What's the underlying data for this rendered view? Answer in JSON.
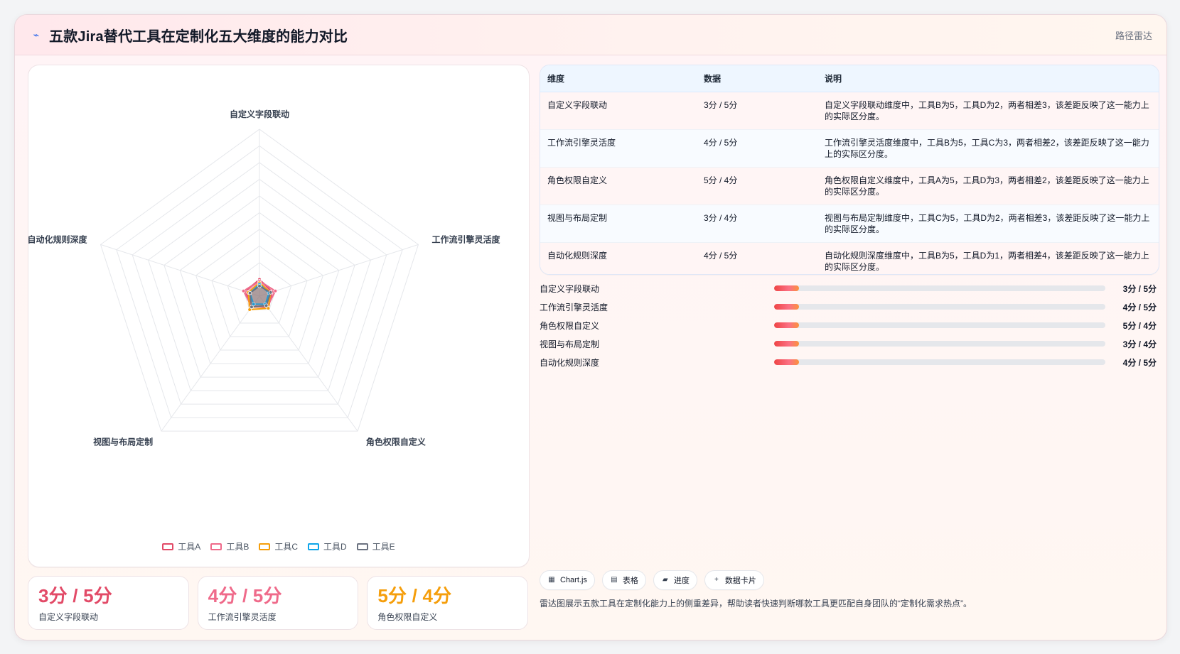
{
  "header": {
    "title": "五款Jira替代工具在定制化五大维度的能力对比",
    "tag": "路径雷达",
    "icon": "chart-line-icon"
  },
  "chart_data": {
    "type": "radar",
    "indicators": [
      "自定义字段联动",
      "工作流引擎灵活度",
      "角色权限自定义",
      "视图与布局定制",
      "自动化规则深度"
    ],
    "rmax": 100,
    "rings": 10,
    "series": [
      {
        "name": "工具A",
        "color": "#e24a67",
        "values": [
          10,
          8,
          9,
          7,
          9
        ]
      },
      {
        "name": "工具B",
        "color": "#ef6a8a",
        "values": [
          9,
          10,
          8,
          8,
          10
        ]
      },
      {
        "name": "工具C",
        "color": "#f59e0b",
        "values": [
          8,
          7,
          9,
          10,
          7
        ]
      },
      {
        "name": "工具D",
        "color": "#0ea5e9",
        "values": [
          7,
          6,
          6,
          6,
          6
        ]
      },
      {
        "name": "工具E",
        "color": "#6b7280",
        "values": [
          6,
          7,
          7,
          8,
          6
        ]
      }
    ],
    "legend": {
      "placement": "bottom"
    }
  },
  "table": {
    "headers": [
      "维度",
      "数据",
      "说明"
    ],
    "rows": [
      [
        "自定义字段联动",
        "3分 / 5分",
        "自定义字段联动维度中，工具B为5，工具D为2，两者相差3，该差距反映了这一能力上的实际区分度。"
      ],
      [
        "工作流引擎灵活度",
        "4分 / 5分",
        "工作流引擎灵活度维度中，工具B为5，工具C为3，两者相差2，该差距反映了这一能力上的实际区分度。"
      ],
      [
        "角色权限自定义",
        "5分 / 4分",
        "角色权限自定义维度中，工具A为5，工具D为3，两者相差2，该差距反映了这一能力上的实际区分度。"
      ],
      [
        "视图与布局定制",
        "3分 / 4分",
        "视图与布局定制维度中，工具C为5，工具D为2，两者相差3，该差距反映了这一能力上的实际区分度。"
      ],
      [
        "自动化规则深度",
        "4分 / 5分",
        "自动化规则深度维度中，工具B为5，工具D为1，两者相差4，该差距反映了这一能力上的实际区分度。"
      ]
    ]
  },
  "progress": {
    "items": [
      {
        "label": "自定义字段联动",
        "value": "3分 / 5分",
        "fill": 0.075
      },
      {
        "label": "工作流引擎灵活度",
        "value": "4分 / 5分",
        "fill": 0.075
      },
      {
        "label": "角色权限自定义",
        "value": "5分 / 4分",
        "fill": 0.075
      },
      {
        "label": "视图与布局定制",
        "value": "3分 / 4分",
        "fill": 0.075
      },
      {
        "label": "自动化规则深度",
        "value": "4分 / 5分",
        "fill": 0.075
      }
    ]
  },
  "stats": [
    {
      "value": "3分 / 5分",
      "label": "自定义字段联动",
      "color": "#e24a67"
    },
    {
      "value": "4分 / 5分",
      "label": "工作流引擎灵活度",
      "color": "#ef6a8a"
    },
    {
      "value": "5分 / 4分",
      "label": "角色权限自定义",
      "color": "#f59e0b"
    }
  ],
  "chips": [
    {
      "label": "Chart.js",
      "icon": "chart-icon"
    },
    {
      "label": "表格",
      "icon": "table-icon"
    },
    {
      "label": "进度",
      "icon": "progress-icon"
    },
    {
      "label": "数据卡片",
      "icon": "plus-icon"
    }
  ],
  "note": "雷达图展示五款工具在定制化能力上的侧重差异，帮助读者快速判断哪款工具更匹配自身团队的“定制化需求热点”。"
}
